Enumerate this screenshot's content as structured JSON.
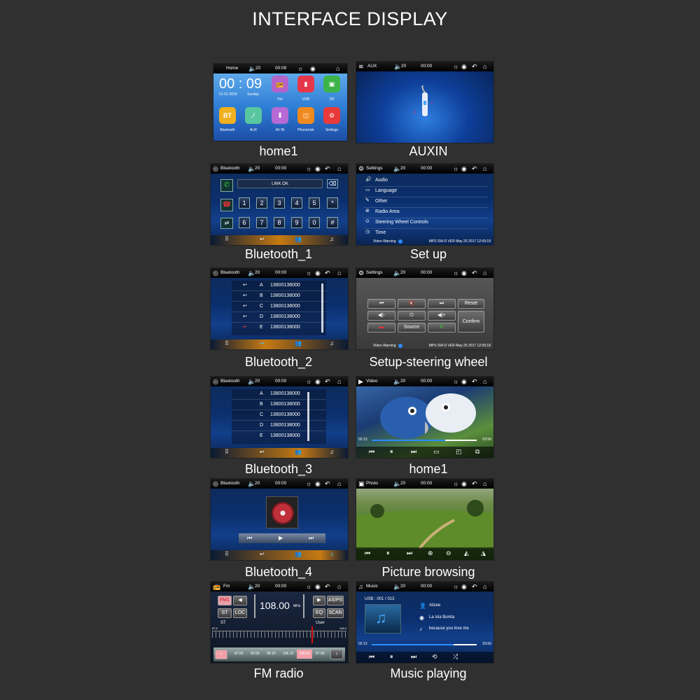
{
  "title": "INTERFACE DISPLAY",
  "captions": [
    "home1",
    "AUXIN",
    "Bluetooth_1",
    "Set up",
    "Bluetooth_2",
    "Setup-steering wheel",
    "Bluetooth_3",
    "home1",
    "Bluetooth_4",
    "Picture browsing",
    "FM radio",
    "Music playing"
  ],
  "home": {
    "label": "Home",
    "vol": "20",
    "time": "00:09",
    "clock": "00 : 09",
    "date": "01-01-2019",
    "day": "Sunday",
    "apps": [
      {
        "label": "Fm",
        "icon": "📻"
      },
      {
        "label": "USB",
        "icon": "▮"
      },
      {
        "label": "SD",
        "icon": "▣"
      },
      {
        "label": "Bluetooth",
        "icon": "BT"
      },
      {
        "label": "AUX",
        "icon": "⁄"
      },
      {
        "label": "AV IN",
        "icon": "⦀"
      },
      {
        "label": "PhoneLink",
        "icon": "◫"
      },
      {
        "label": "Settings",
        "icon": "⚙"
      }
    ]
  },
  "aux": {
    "label": "AUX",
    "vol": "20",
    "time": "00:00"
  },
  "bt1": {
    "label": "Bluetooth",
    "vol": "20",
    "time": "00:00",
    "status": "LINK OK",
    "keys": [
      "1",
      "2",
      "3",
      "4",
      "5",
      "*",
      "6",
      "7",
      "8",
      "9",
      "0",
      "#"
    ]
  },
  "setup": {
    "label": "Settings",
    "vol": "20",
    "time": "00:00",
    "items": [
      "Audio",
      "Language",
      "Other",
      "Radio Area",
      "Steering Wheel Controls",
      "Time"
    ],
    "warning": "Video Warning",
    "version": "MPS SW-D VER May 25 2017 12:09:18"
  },
  "bt2": {
    "label": "Bluetooth",
    "vol": "20",
    "time": "00:00",
    "contacts": [
      {
        "letter": "A",
        "number": "13800138000"
      },
      {
        "letter": "B",
        "number": "13800138000"
      },
      {
        "letter": "C",
        "number": "13800138000"
      },
      {
        "letter": "D",
        "number": "13800138000"
      },
      {
        "letter": "E",
        "number": "13800138000"
      }
    ]
  },
  "steer": {
    "label": "Settings",
    "vol": "20",
    "time": "00:00",
    "buttons": [
      "⏮",
      "🔇",
      "⏭",
      "◀)-",
      "⏻",
      "◀)+",
      "",
      "Source",
      ""
    ],
    "reset": "Reset",
    "confirm": "Confirm",
    "warning": "Video Warning",
    "version": "MPS SW-D VER May 25 2017 12:09:18"
  },
  "bt3": {
    "label": "Bluetooth",
    "vol": "20",
    "time": "00:00",
    "contacts": [
      {
        "letter": "A",
        "number": "13800138000"
      },
      {
        "letter": "B",
        "number": "13800138000"
      },
      {
        "letter": "C",
        "number": "13800138000"
      },
      {
        "letter": "D",
        "number": "13800138000"
      },
      {
        "letter": "E",
        "number": "13800138000"
      }
    ]
  },
  "video": {
    "label": "Video",
    "vol": "20",
    "time": "00:00",
    "elapsed": "02:13",
    "remaining": "03:56",
    "progress": 0.7
  },
  "bt4": {
    "label": "Bluetooth",
    "vol": "20",
    "time": "00:00"
  },
  "photo": {
    "label": "Photo",
    "vol": "20",
    "time": "00:00"
  },
  "fm": {
    "label": "Fm",
    "vol": "20",
    "time": "00:00",
    "band": "FM1",
    "freq": "108.00",
    "unit": "MHz",
    "st": "ST",
    "loc": "LOC",
    "asps": "AS/PS",
    "eq": "EQ",
    "scan": "SCAN",
    "mode_st": "ST",
    "mode_user": "User",
    "scale_min": "87.5",
    "scale_max": "108.0",
    "presets": [
      "87.50",
      "90.50",
      "98.10",
      "106.10",
      "108.00",
      "87.50"
    ]
  },
  "music": {
    "label": "Music",
    "vol": "20",
    "time": "00:00",
    "track": "USB : 001 / 013",
    "artist": "Alizee",
    "album": "La Isla Bonita",
    "song": "because you love me",
    "elapsed": "02:13",
    "remaining": "03:56",
    "progress": 0.78
  }
}
